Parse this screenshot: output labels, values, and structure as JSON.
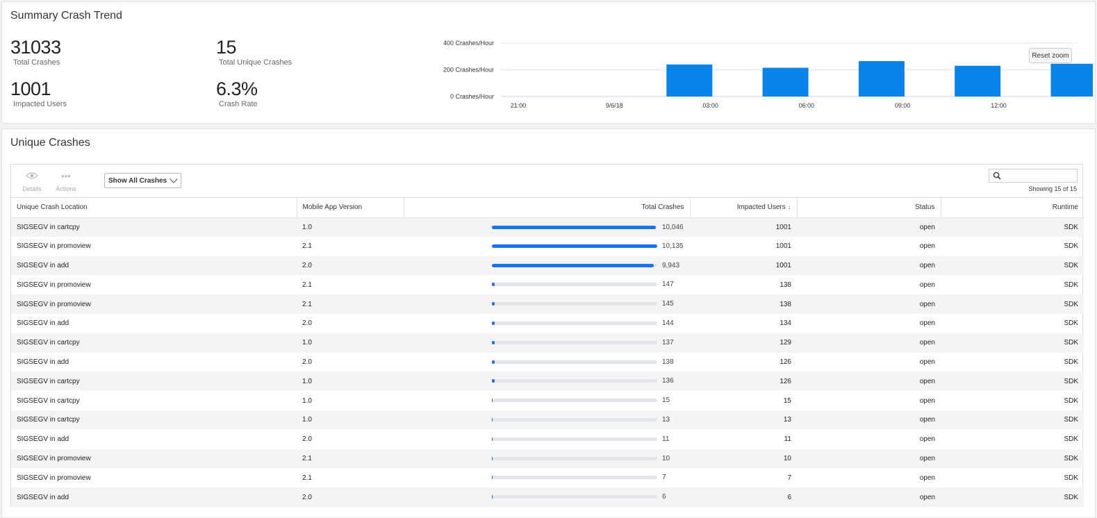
{
  "summary": {
    "title": "Summary Crash Trend",
    "stats": [
      {
        "value": "31033",
        "label": "Total Crashes"
      },
      {
        "value": "15",
        "label": "Total Unique Crashes"
      },
      {
        "value": "1001",
        "label": "Impacted Users"
      },
      {
        "value": "6.3%",
        "label": "Crash Rate"
      }
    ],
    "reset_zoom_label": "Reset zoom"
  },
  "chart_data": {
    "type": "bar",
    "title": "",
    "categories": [
      "21:00",
      "9/6/18",
      "03:00",
      "06:00",
      "09:00",
      "12:00"
    ],
    "values": [
      0,
      240,
      215,
      265,
      230,
      245
    ],
    "y_ticks": [
      "0 Crashes/Hour",
      "200 Crashes/Hour",
      "400 Crashes/Hour"
    ],
    "ylim": [
      0,
      400
    ],
    "grid": true,
    "bar_color": "#0a83e8"
  },
  "unique": {
    "title": "Unique Crashes",
    "toolbar": {
      "details_label": "Details",
      "actions_label": "Actions",
      "filter_value": "Show All Crashes",
      "search_placeholder": "",
      "showing_text": "Showing 15 of 15"
    },
    "columns": [
      "Unique Crash Location",
      "Mobile App Version",
      "Total Crashes",
      "Impacted Users",
      "Status",
      "Runtime"
    ],
    "sort_indicator": "↓",
    "max_crashes": 10135,
    "rows": [
      {
        "location": "SIGSEGV in cartcpy",
        "version": "1.0",
        "crashes": 10046,
        "crashes_label": "10,046",
        "users": "1001",
        "status": "open",
        "runtime": "SDK"
      },
      {
        "location": "SIGSEGV in promoview",
        "version": "2.1",
        "crashes": 10135,
        "crashes_label": "10,135",
        "users": "1001",
        "status": "open",
        "runtime": "SDK"
      },
      {
        "location": "SIGSEGV in add",
        "version": "2.0",
        "crashes": 9943,
        "crashes_label": "9,943",
        "users": "1001",
        "status": "open",
        "runtime": "SDK"
      },
      {
        "location": "SIGSEGV in promoview",
        "version": "2.1",
        "crashes": 147,
        "crashes_label": "147",
        "users": "138",
        "status": "open",
        "runtime": "SDK"
      },
      {
        "location": "SIGSEGV in promoview",
        "version": "2.1",
        "crashes": 145,
        "crashes_label": "145",
        "users": "138",
        "status": "open",
        "runtime": "SDK"
      },
      {
        "location": "SIGSEGV in add",
        "version": "2.0",
        "crashes": 144,
        "crashes_label": "144",
        "users": "134",
        "status": "open",
        "runtime": "SDK"
      },
      {
        "location": "SIGSEGV in cartcpy",
        "version": "1.0",
        "crashes": 137,
        "crashes_label": "137",
        "users": "129",
        "status": "open",
        "runtime": "SDK"
      },
      {
        "location": "SIGSEGV in add",
        "version": "2.0",
        "crashes": 138,
        "crashes_label": "138",
        "users": "126",
        "status": "open",
        "runtime": "SDK"
      },
      {
        "location": "SIGSEGV in cartcpy",
        "version": "1.0",
        "crashes": 136,
        "crashes_label": "136",
        "users": "126",
        "status": "open",
        "runtime": "SDK"
      },
      {
        "location": "SIGSEGV in cartcpy",
        "version": "1.0",
        "crashes": 15,
        "crashes_label": "15",
        "users": "15",
        "status": "open",
        "runtime": "SDK"
      },
      {
        "location": "SIGSEGV in cartcpy",
        "version": "1.0",
        "crashes": 13,
        "crashes_label": "13",
        "users": "13",
        "status": "open",
        "runtime": "SDK"
      },
      {
        "location": "SIGSEGV in add",
        "version": "2.0",
        "crashes": 11,
        "crashes_label": "11",
        "users": "11",
        "status": "open",
        "runtime": "SDK"
      },
      {
        "location": "SIGSEGV in promoview",
        "version": "2.1",
        "crashes": 10,
        "crashes_label": "10",
        "users": "10",
        "status": "open",
        "runtime": "SDK"
      },
      {
        "location": "SIGSEGV in promoview",
        "version": "2.1",
        "crashes": 7,
        "crashes_label": "7",
        "users": "7",
        "status": "open",
        "runtime": "SDK"
      },
      {
        "location": "SIGSEGV in add",
        "version": "2.0",
        "crashes": 6,
        "crashes_label": "6",
        "users": "6",
        "status": "open",
        "runtime": "SDK"
      }
    ]
  }
}
